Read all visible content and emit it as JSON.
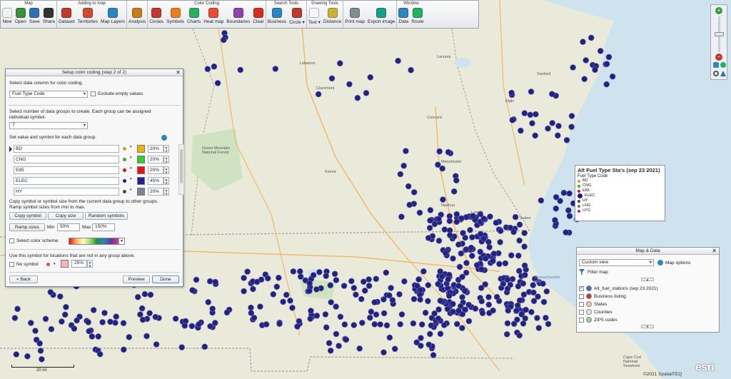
{
  "ribbon": {
    "groups": [
      {
        "title": "Map",
        "buttons": [
          {
            "label": "New",
            "icon": "new-doc-icon",
            "color": "#f2f2f2"
          },
          {
            "label": "Open",
            "icon": "open-folder-icon",
            "color": "#3a8f3a"
          },
          {
            "label": "Save",
            "icon": "save-disk-icon",
            "color": "#2f6db5"
          },
          {
            "label": "Share",
            "icon": "share-icon",
            "color": "#333333"
          }
        ]
      },
      {
        "title": "Adding to map",
        "buttons": [
          {
            "label": "Dataset",
            "icon": "dataset-icon",
            "color": "#c0392b"
          },
          {
            "label": "Territories",
            "icon": "territories-icon",
            "color": "#d24a2e"
          },
          {
            "label": "Map Layers",
            "icon": "globe-icon",
            "color": "#2e86c1"
          }
        ]
      },
      {
        "title": "",
        "buttons": [
          {
            "label": "Analysis",
            "icon": "analysis-icon",
            "color": "#c97b1a"
          }
        ]
      },
      {
        "title": "Color Coding",
        "buttons": [
          {
            "label": "Circles",
            "icon": "circles-icon",
            "color": "#c0392b"
          },
          {
            "label": "Symbols",
            "icon": "symbols-icon",
            "color": "#e67e22"
          },
          {
            "label": "Charts",
            "icon": "charts-icon",
            "color": "#27ae60"
          },
          {
            "label": "Heat map",
            "icon": "heat-map-icon",
            "color": "#e74c3c"
          },
          {
            "label": "Boundaries",
            "icon": "boundaries-icon",
            "color": "#8e44ad"
          },
          {
            "label": "Clear",
            "icon": "clear-icon",
            "color": "#d62d20"
          }
        ]
      },
      {
        "title": "Search Tools",
        "buttons": [
          {
            "label": "Business",
            "icon": "business-icon",
            "color": "#2e86c1"
          },
          {
            "label": "Circle ▾",
            "icon": "circle-search-icon",
            "color": "#c0392b"
          }
        ]
      },
      {
        "title": "Drawing Tools",
        "buttons": [
          {
            "label": "Text ▾",
            "icon": "text-icon",
            "color": "#f5f5f5"
          },
          {
            "label": "Distance",
            "icon": "distance-icon",
            "color": "#c9b037"
          }
        ]
      },
      {
        "title": "",
        "buttons": [
          {
            "label": "Print map",
            "icon": "print-icon",
            "color": "#7f8c8d"
          },
          {
            "label": "Export image",
            "icon": "export-image-icon",
            "color": "#16a085"
          }
        ]
      },
      {
        "title": "Window",
        "buttons": [
          {
            "label": "Data",
            "icon": "data-icon",
            "color": "#2e86c1"
          },
          {
            "label": "Route",
            "icon": "route-icon",
            "color": "#27ae60"
          }
        ]
      }
    ]
  },
  "dialog": {
    "title": "Setup color coding (step 2 of 2)",
    "select_column_label": "Select data column for color coding.",
    "column_value": "Fuel Type Code",
    "exclude_empty_label": "Exclude empty values",
    "groups_label_1": "Select number of data groups to create. Each group can be assigned",
    "groups_label_2": "individual symbol.",
    "groups_value": "7",
    "set_value_label": "Set value and symbol for each data group.",
    "rows": [
      {
        "name": "BD",
        "dot": "#d4a017",
        "swatch": "#f1b500",
        "pct": "20%"
      },
      {
        "name": "CNG",
        "dot": "#32b032",
        "swatch": "#2fd12f",
        "pct": "20%"
      },
      {
        "name": "E85",
        "dot": "#d11",
        "swatch": "#ee1111",
        "pct": "20%"
      },
      {
        "name": "ELEC",
        "dot": "#1c1c8c",
        "swatch": "#1f1fa0",
        "pct": "45%"
      },
      {
        "name": "HY",
        "dot": "#444a55",
        "swatch": "#7a8594",
        "pct": "20%"
      }
    ],
    "copy_label_1": "Copy symbol or symbol size from the current data group to other groups.",
    "copy_label_2": "Ramp symbol sizes from min to max.",
    "copy_symbol": "Copy symbol",
    "copy_size": "Copy size",
    "random_symbols": "Random symbols",
    "ramp_sizes": "Ramp sizes",
    "min_label": "Min",
    "min_value": "50%",
    "max_label": "Max",
    "max_value": "150%",
    "color_scheme_label": "Select color scheme",
    "unmatched_label": "Use this symbol for locations that are not in any group above.",
    "no_symbol_label": "No symbol",
    "unmatched_pct": "25%",
    "back": "< Back",
    "preview": "Preview",
    "done": "Done"
  },
  "legend": {
    "title": "Alt Fuel Type Sta's (sep 23 2021)",
    "subtitle": "Fuel Type Code",
    "items": [
      {
        "label": "BD",
        "color": "#d4a017"
      },
      {
        "label": "CNG",
        "color": "#32b032"
      },
      {
        "label": "E85",
        "color": "#dd1111"
      },
      {
        "label": "ELEC",
        "color": "#1c1c8c"
      },
      {
        "label": "HY",
        "color": "#444a55"
      },
      {
        "label": "LNG",
        "color": "#8a6d3b"
      },
      {
        "label": "LPG",
        "color": "#9a2a9a"
      }
    ]
  },
  "mapdata": {
    "title": "Map & Data",
    "view_value": "Custom view",
    "map_options": "Map options",
    "filter_map": "Filter map",
    "layers": [
      {
        "label": "Alt_fuel_stations (sep 23 2021)",
        "checked": true,
        "icon": "#3f6fbf"
      },
      {
        "label": "Business listing",
        "checked": false,
        "icon": "#c0392b"
      },
      {
        "label": "States",
        "checked": false,
        "icon": "#f5c89a"
      },
      {
        "label": "Counties",
        "checked": false,
        "icon": "#e6e6e6"
      },
      {
        "label": "ZIP5 codes",
        "checked": false,
        "icon": "#8fd68f"
      }
    ]
  },
  "map": {
    "places": [
      "Concord",
      "Manchester",
      "Nashua",
      "Lowell",
      "Salem",
      "Claremont",
      "Lebanon",
      "Laconia",
      "Keene",
      "Sanford",
      "Elgin",
      "Green Mountain National Forest",
      "Massachusetts Bay",
      "Cape Cod National Seashore"
    ],
    "scale_label": "20 mi",
    "attribution": "©2021 SpatialTEQ",
    "esri": "esri"
  }
}
